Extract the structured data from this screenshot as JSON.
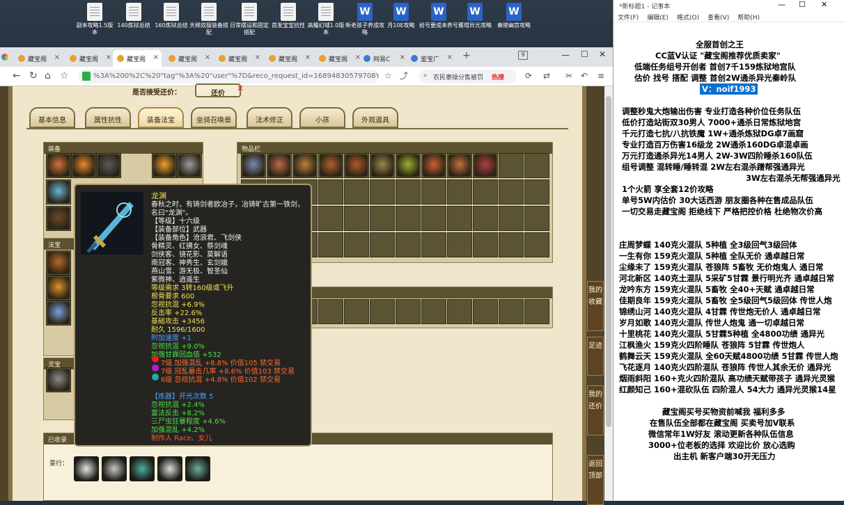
{
  "desktop": {
    "icons": [
      {
        "label": "副本攻略1.5版本",
        "type": "doc"
      },
      {
        "label": "140炼狱总结",
        "type": "doc"
      },
      {
        "label": "160炼狱总结",
        "type": "doc"
      },
      {
        "label": "天梯双服装备搭配",
        "type": "doc"
      },
      {
        "label": "日常摆设和固定搭配",
        "type": "doc"
      },
      {
        "label": "首发宝宝抗性",
        "type": "doc"
      },
      {
        "label": "高耀幻域1.0版本",
        "type": "doc"
      },
      {
        "label": "新老孩子养成攻略",
        "type": "word"
      },
      {
        "label": "月10E攻略",
        "type": "word"
      },
      {
        "label": "给号要成本养号",
        "type": "word"
      },
      {
        "label": "雁塔异光攻略",
        "type": "word"
      },
      {
        "label": "秦陵幽宫攻略",
        "type": "word"
      }
    ]
  },
  "browser": {
    "tabs": [
      {
        "label": "藏宝阁"
      },
      {
        "label": "藏宝阁"
      },
      {
        "label": "藏宝阁"
      },
      {
        "label": "藏宝阁"
      },
      {
        "label": "藏宝阁"
      },
      {
        "label": "藏宝阁"
      },
      {
        "label": "藏宝阁"
      },
      {
        "label": "网易C"
      },
      {
        "label": "鉴宝广"
      }
    ],
    "tab_count": "9",
    "url": "%3A%200%2C%20\"tag\"%3A%20\"user\"%7D&reco_request_id=16894830579708YSG2",
    "search": "农民寨操分售被罚",
    "hot": "热搜"
  },
  "game": {
    "price_label": "是否接受还价：",
    "price_button": "还价",
    "tabs": [
      "基本信息",
      "属性抗性",
      "装备法宝",
      "坐骑召唤兽",
      "法术修正",
      "小孩",
      "外观道具"
    ],
    "panels": {
      "equip": "装备",
      "fabao": "法宝",
      "lingbao": "灵宝",
      "inventory": "物品栏",
      "collected": "已收录",
      "scenery": "景行："
    },
    "side_buttons": [
      "我的收藏",
      "足迹",
      "我的还价",
      "返回顶部"
    ]
  },
  "tooltip": {
    "name": "龙渊",
    "lines": [
      {
        "t": "春秋之时，有铸剑者欧冶子，冶铸旷古第一铁剑，",
        "c": "#f2f2f2"
      },
      {
        "t": "名曰\"龙渊\"。",
        "c": "#f2f2f2"
      },
      {
        "t": "【等级】十六级",
        "c": "#f2f2f2"
      },
      {
        "t": "【装备部位】武器",
        "c": "#f2f2f2"
      },
      {
        "t": "【装备角色】沧浪君、飞剑侠",
        "c": "#f2f2f2"
      },
      {
        "t": "骨精灵、红拂女、祭剑魂",
        "c": "#f2f2f2"
      },
      {
        "t": "剑侠客、镜花影、莫解语",
        "c": "#f2f2f2"
      },
      {
        "t": "南冠客、神秀生、玄剑娥",
        "c": "#f2f2f2"
      },
      {
        "t": "燕山雪、游无极、智圣仙",
        "c": "#f2f2f2"
      },
      {
        "t": "紫微神、逍遥生",
        "c": "#f2f2f2"
      },
      {
        "t": "等级需求 3转160级或飞升",
        "c": "#f0e050"
      },
      {
        "t": "根骨要求 600",
        "c": "#f0e050"
      },
      {
        "t": "忽视抗混 +6.9%",
        "c": "#f0e050"
      },
      {
        "t": "反击率 +22.6%",
        "c": "#f0e050"
      },
      {
        "t": "基础攻击 +3456",
        "c": "#f0e050"
      },
      {
        "t": "耐久 1596/1600",
        "c": "#f0e050"
      },
      {
        "t": "附加速度 +1",
        "c": "#4aa0ff"
      },
      {
        "t": "忽视抗混 +9.0%",
        "c": "#4ae04a"
      },
      {
        "t": "加强甘霖回血值 +532",
        "c": "#4ae04a"
      },
      {
        "t": "7级 加强混乱 +8.8% 价值105 禁交易",
        "c": "#ff6a2a"
      },
      {
        "t": "7级 冠乱暴击几率 +8.6% 价值103 禁交易",
        "c": "#ff6a2a"
      },
      {
        "t": "6级 忽视抗混 +4.8% 价值102 禁交易",
        "c": "#ff6a2a"
      },
      {
        "t": "",
        "c": "#f2f2f2"
      },
      {
        "t": "【炼器】开光次数 5",
        "c": "#4aa0ff"
      },
      {
        "t": "忽视抗混 +2.4%",
        "c": "#4ae04a"
      },
      {
        "t": "雷法反击 +8.2%",
        "c": "#4ae04a"
      },
      {
        "t": "三尸虫狂暴程度 +4.6%",
        "c": "#4ae04a"
      },
      {
        "t": "加强混乱 +4.2%",
        "c": "#4ae04a"
      },
      {
        "t": "制作人 Race、女儿",
        "c": "#ff5a2a"
      }
    ]
  },
  "notepad": {
    "title": "*新标题1 - 记事本",
    "menu": [
      "文件(F)",
      "编辑(E)",
      "格式(O)",
      "查看(V)",
      "帮助(H)"
    ],
    "lines": [
      "全服首创之王",
      "CC蓝V认证 \"藏宝阁推荐优质卖家\"",
      "低端任务组号开创者          首创7千159炼狱地宫队",
      "估价 找号 搭配 调整          首创2W通杀异光秦岭队",
      "V：noif1993",
      "调整秒鬼大炮输出伤害          专业打造各种价位任务队伍",
      "低价打造站街双30男人            7000+通杀日常炼狱地宫",
      "千元打造七抗/八抗铁魔            1W+通杀炼狱DG卓7画窟",
      "专业打造百万伤害16级龙          2W通杀160DG卓混卓画",
      "万元打造通杀异光14男人          2W-3W四阶睡杀160队伍",
      "组号调整 混转睡/睡转混           2W左右混杀蹭帮强通异光",
      "3W左右混杀无帮强通异光",
      "1个火箭 享全套12价攻略",
      "单号5W内估价 30大话西游          朋友圈各种在售成品队伍",
      "一切交易走藏宝阁 拒绝线下        严格把控价格 杜绝物次价高",
      "庄周梦蝶 140克火混队 5种植 全3级回气3级回体",
      "一生有你 159克火混队 5种植 全队无价 通卓越日常",
      "尘缘未了 159克火混队 苍狼阵 5畜牧 无价炮鬼人 通日常",
      "河北新区 140克土混队 5采矿5甘霖 景行明光齐 通卓越日常",
      "龙吟东方 159克火混队 5畜牧 全40+天赋 通卓越日常",
      "佳期良年 159克火混队 5畜牧 全5级回气5级回体 传世人炮",
      "锦绣山河 140克火混队 4甘霖 传世炮无价人 通卓越日常",
      "岁月如歌 140克火混队 传世人炮鬼 通一切卓越日常",
      "十里桃花 140克火混队 5甘霖5种植 全4800功绩 通异光",
      "江枫渔火 159克火四阶睡队 苍狼阵 5甘霖 传世炮人",
      "鹤舞云天 159克火混队 全60天赋4800功绩 5甘霖 传世人炮",
      "飞花逐月 140克火四阶混队 苍狼阵 传世人其余无价 通异光",
      "烟雨斜阳 160+克火四阶混队 高功绩天赋带孩子 通异光灵猴",
      "红颜知己 160+混砍队伍 四阶混人 54大力 通异光灵猴14星",
      "藏宝阁买号买物资前喊我 福利多多",
      "在售队伍全部都在藏宝阁 买卖号加V联系",
      "微信常年1W好友 滚动更新各种队伍信息",
      "3000+位老板的选择 欢迎比价 放心选购",
      "出主机 新客户端30开无压力"
    ]
  },
  "colors": {
    "accent": "#0b6fd0",
    "game_bg": "#efe6cc",
    "tooltip_bg": "#262421"
  }
}
